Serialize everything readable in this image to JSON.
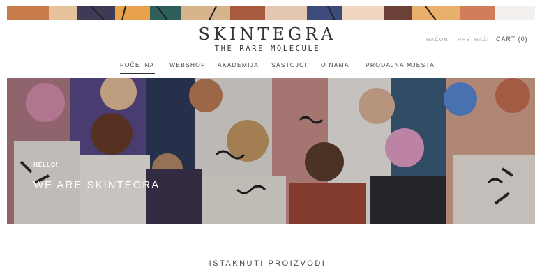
{
  "brand": {
    "name": "SKINTEGRA",
    "tagline": "THE RARE MOLECULE"
  },
  "utility": {
    "account": "RAČUN",
    "search": "PRETRAŽI",
    "cart": "CART (0)"
  },
  "nav": {
    "items": [
      {
        "label": "POČETNA",
        "active": true
      },
      {
        "label": "WEBSHOP",
        "active": false
      },
      {
        "label": "AKADEMIJA",
        "active": false
      },
      {
        "label": "SASTOJCI",
        "active": false
      },
      {
        "label": "O NAMA",
        "active": false
      },
      {
        "label": "PRODAJNA MJESTA",
        "active": false
      }
    ]
  },
  "hero": {
    "eyebrow": "HELLO!",
    "title": "WE ARE SKINTEGRA"
  },
  "featured": {
    "title": "ISTAKNUTI PROIZVODI"
  },
  "colors": {
    "accent": "#333333",
    "muted": "#9a9a9a",
    "hero_bg": "#6b4d45"
  }
}
